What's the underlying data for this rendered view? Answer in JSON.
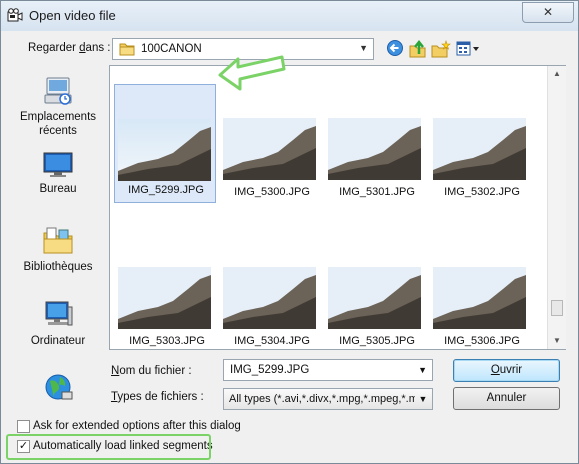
{
  "window": {
    "title": "Open video file",
    "close_glyph": "✕"
  },
  "lookin": {
    "label_pre": "Regarder ",
    "label_key": "d",
    "label_post": "ans :",
    "value": "100CANON"
  },
  "toolbar": {
    "icons": [
      "back-icon",
      "up-folder-icon",
      "new-folder-icon",
      "view-menu-icon"
    ]
  },
  "places": [
    {
      "label_lines": [
        "Emplacements",
        "récents"
      ],
      "icon": "recent-places-icon"
    },
    {
      "label_lines": [
        "Bureau"
      ],
      "icon": "desktop-icon"
    },
    {
      "label_lines": [
        "Bibliothèques"
      ],
      "icon": "libraries-icon"
    },
    {
      "label_lines": [
        "Ordinateur"
      ],
      "icon": "computer-icon"
    },
    {
      "label_lines": [],
      "icon": "network-icon"
    }
  ],
  "files": [
    {
      "name": "IMG_5299.JPG",
      "selected": true
    },
    {
      "name": "IMG_5300.JPG",
      "selected": false
    },
    {
      "name": "IMG_5301.JPG",
      "selected": false
    },
    {
      "name": "IMG_5302.JPG",
      "selected": false
    },
    {
      "name": "IMG_5303.JPG",
      "selected": false
    },
    {
      "name": "IMG_5304.JPG",
      "selected": false
    },
    {
      "name": "IMG_5305.JPG",
      "selected": false
    },
    {
      "name": "IMG_5306.JPG",
      "selected": false
    }
  ],
  "filename": {
    "label_key": "N",
    "label_post": "om du fichier :",
    "value": "IMG_5299.JPG"
  },
  "filetype": {
    "label_key": "T",
    "label_post": "ypes de fichiers :",
    "value": "All types (*.avi,*.divx,*.mpg,*.mpeg,*.mp"
  },
  "buttons": {
    "open_key": "O",
    "open_post": "uvrir",
    "cancel": "Annuler"
  },
  "options": {
    "extended": {
      "label": "Ask for extended options after this dialog",
      "checked": false
    },
    "linked": {
      "label": "Automatically load linked segments",
      "checked": true
    }
  },
  "colors": {
    "highlight": "#7bd368",
    "selection": "#dde9f8",
    "accent": "#3c7fb1"
  }
}
